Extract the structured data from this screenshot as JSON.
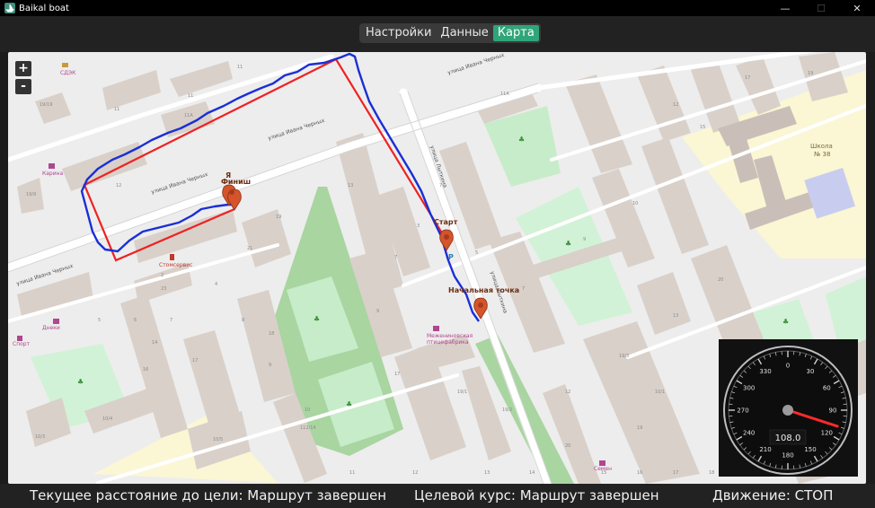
{
  "window": {
    "title": "Baikal boat",
    "minimize_glyph": "—",
    "maximize_glyph": "☐",
    "close_glyph": "✕"
  },
  "tabs": [
    {
      "label": "Настройки",
      "active": false
    },
    {
      "label": "Данные",
      "active": false
    },
    {
      "label": "Карта",
      "active": true
    }
  ],
  "map": {
    "zoom_in_label": "+",
    "zoom_out_label": "-",
    "streets": [
      "улица Ивана Черных",
      "улица Ивана Черных",
      "улица Ивана Черных",
      "улица Ивана Черных",
      "улица Лыткина",
      "улица Лыткина"
    ],
    "pois": [
      "СДЭК",
      "Карина",
      "Стомсервис",
      "Днеки",
      "Спорт",
      "Школа",
      "№ 38",
      "Межениновская",
      "птицефабрика",
      "Семен"
    ],
    "markers": [
      {
        "label": "Финиш",
        "top_label": "Я"
      },
      {
        "label": "Старт"
      },
      {
        "label": "Начальная точка"
      }
    ],
    "parking_label": "P",
    "house_numbers": [
      "11",
      "11",
      "11А",
      "11",
      "13",
      "19",
      "21",
      "23",
      "11А",
      "3",
      "5",
      "7",
      "9",
      "10",
      "12",
      "15",
      "17",
      "19",
      "20",
      "13",
      "14",
      "16",
      "17",
      "18",
      "17",
      "19/1",
      "19/2",
      "19/3",
      "10/1",
      "10/2",
      "10/3",
      "10/4",
      "10/5",
      "112/14",
      "19/9",
      "19/19",
      "7",
      "7",
      "9",
      "12",
      "19",
      "20",
      "12",
      "2",
      "4",
      "5",
      "6",
      "7",
      "8",
      "9",
      "10",
      "11",
      "12",
      "13",
      "14",
      "15",
      "16",
      "17",
      "18",
      "25"
    ]
  },
  "compass": {
    "ticks": [
      "0",
      "30",
      "60",
      "90",
      "120",
      "150",
      "180",
      "210",
      "240",
      "270",
      "300",
      "330"
    ],
    "heading_value": "108.0",
    "heading_deg": 108,
    "needle_color": "#ff2a2a"
  },
  "status": {
    "distance_text": "Текущее расстояние до цели: Маршрут завершен",
    "course_text": "Целевой курс: Маршрут завершен",
    "motion_text": "Движение: СТОП"
  },
  "colors": {
    "accent": "#2fa57a",
    "route": "#ee2222",
    "track": "#1f2fd0",
    "marker": "#d4552b"
  }
}
